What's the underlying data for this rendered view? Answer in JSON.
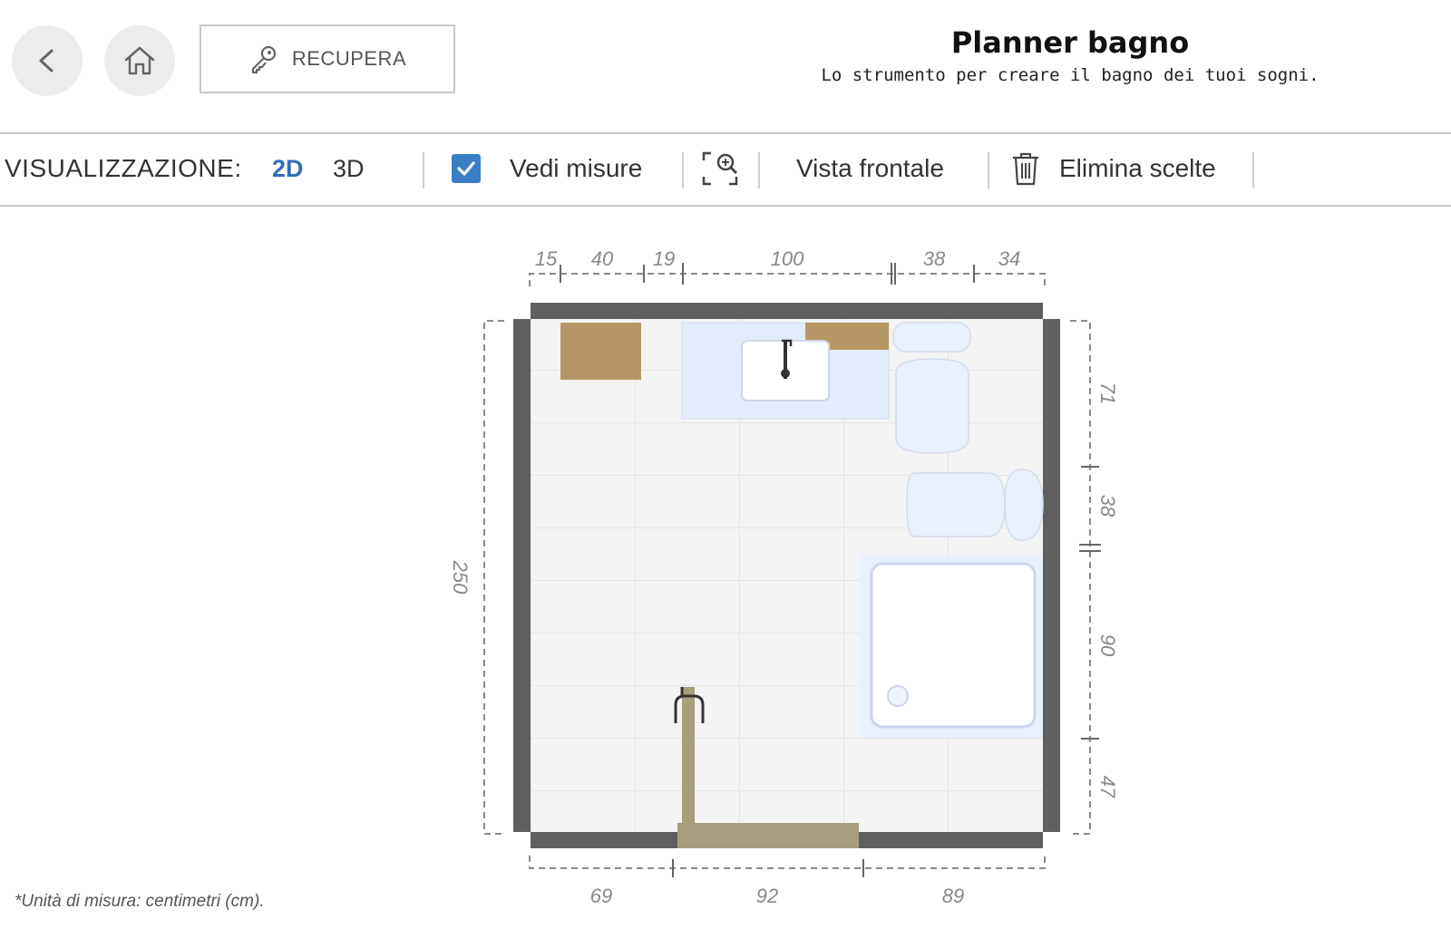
{
  "header": {
    "title": "Planner bagno",
    "subtitle": "Lo strumento per creare il bagno dei tuoi sogni.",
    "back_icon": "chevron-left-icon",
    "home_icon": "home-icon",
    "recupera_label": "RECUPERA",
    "recupera_icon": "key-icon"
  },
  "toolbar": {
    "view_label": "VISUALIZZAZIONE:",
    "modes": [
      {
        "label": "2D",
        "active": true
      },
      {
        "label": "3D",
        "active": false
      }
    ],
    "measures_label": "Vedi misure",
    "measures_checked": true,
    "zoom_icon": "zoom-fit-icon",
    "front_view_label": "Vista frontale",
    "delete_label": "Elimina scelte",
    "delete_icon": "trash-icon",
    "accent_color": "#3a7fc5"
  },
  "plan": {
    "top_dimensions": [
      "15",
      "40",
      "19",
      "100",
      "38",
      "34"
    ],
    "bottom_dimensions": [
      "69",
      "92",
      "89"
    ],
    "left_dimension": "250",
    "right_dimensions": [
      "71",
      "38",
      "90",
      "47"
    ]
  },
  "footnote": "*Unità di misura: centimetri (cm)."
}
